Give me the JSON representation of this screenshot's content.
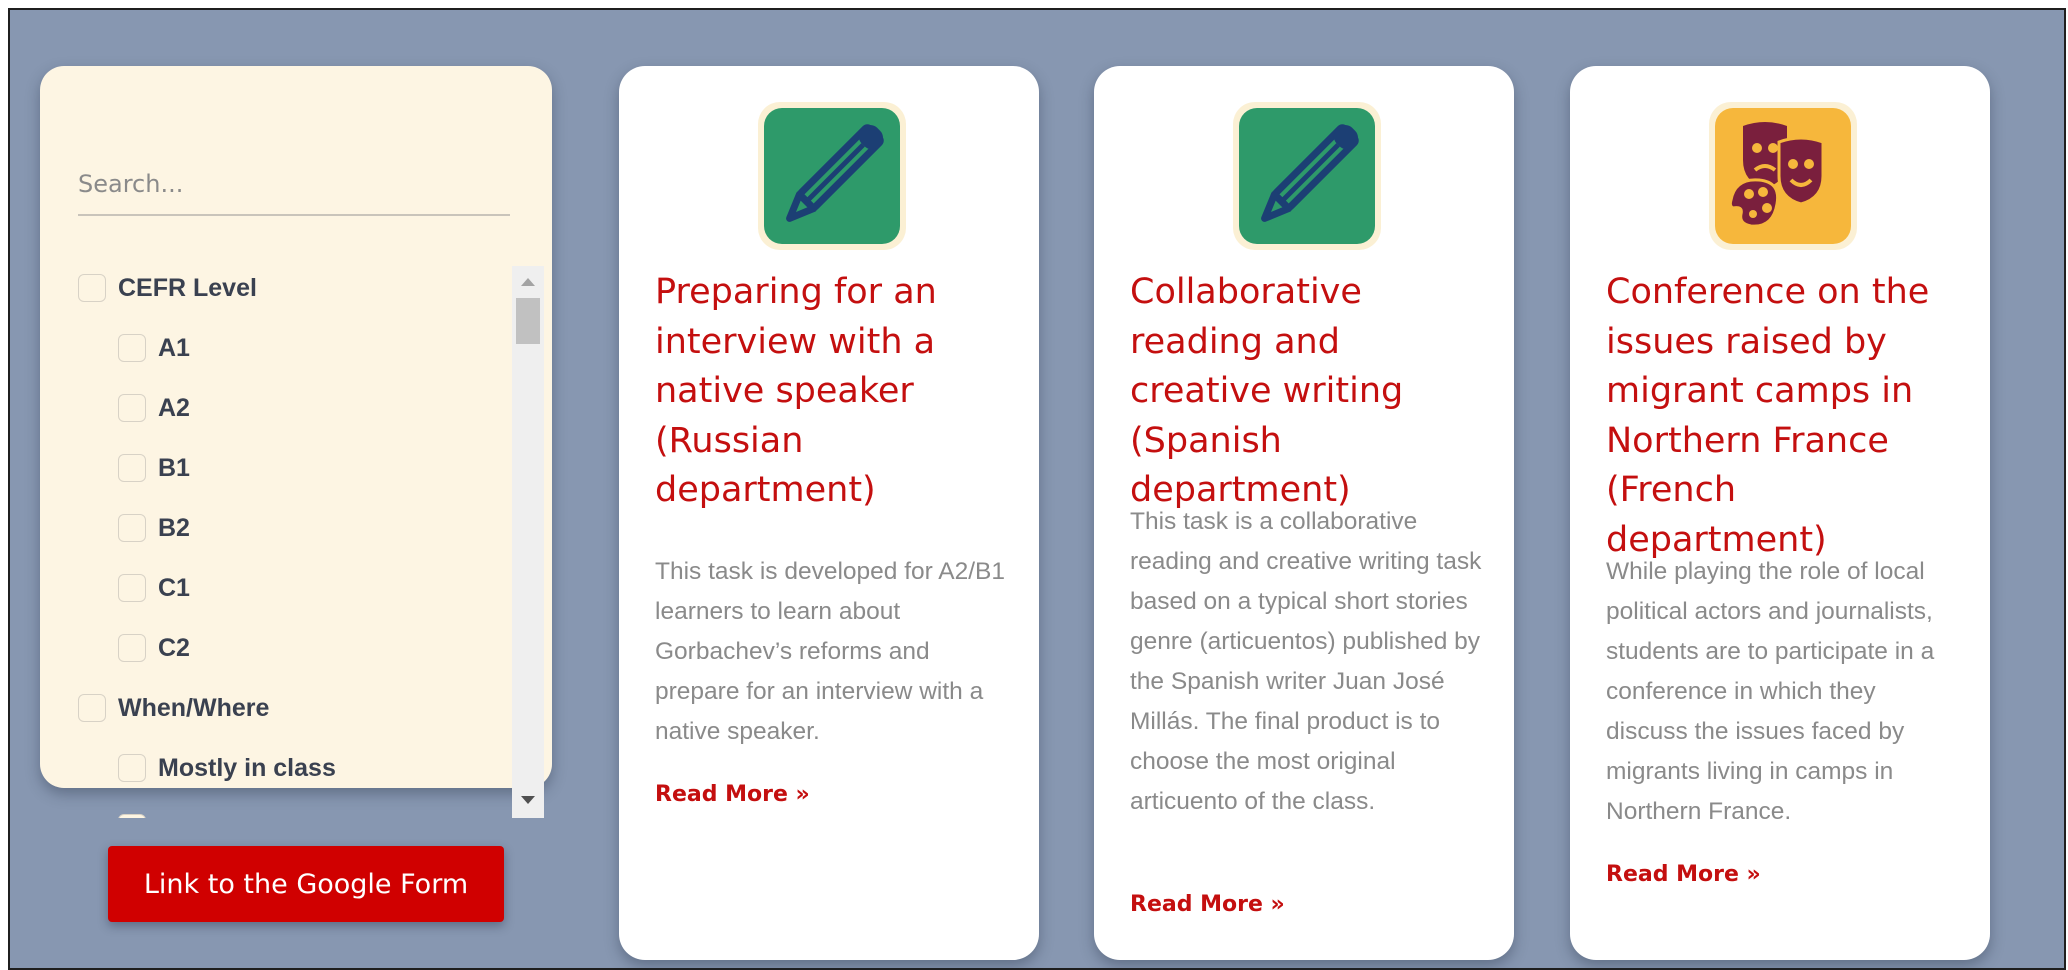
{
  "filter_panel": {
    "search": {
      "placeholder": "Search...",
      "value": ""
    },
    "items": [
      {
        "label": "CEFR Level"
      },
      {
        "label": "A1"
      },
      {
        "label": "A2"
      },
      {
        "label": "B1"
      },
      {
        "label": "B2"
      },
      {
        "label": "C1"
      },
      {
        "label": "C2"
      },
      {
        "label": "When/Where"
      },
      {
        "label": "Mostly in class"
      }
    ]
  },
  "form_button": {
    "label": "Link to the Google Form"
  },
  "cards": [
    {
      "icon": "pencil-icon",
      "title": "Preparing for an interview with a native speaker (Russian department)",
      "description": "This task is developed for A2/B1 learners to learn about Gorbachev’s reforms and prepare for an interview with a native speaker.",
      "link": "Read More »"
    },
    {
      "icon": "pencil-icon",
      "title": "Collaborative reading and creative writing (Spanish department)",
      "description": "This task is a collaborative reading and creative writing task based on a typical short stories genre (articuentos) published by the Spanish writer Juan José Millás. The final product is to choose the most original articuento of the class.",
      "link": "Read More »"
    },
    {
      "icon": "theater-masks-palette-icon",
      "title": "Conference on the issues raised by migrant camps in Northern France (French department)",
      "description": "While playing the role of local political actors and journalists, students are to participate in a conference in which they discuss the issues faced by migrants living in camps in Northern France.",
      "link": "Read More »"
    }
  ],
  "colors": {
    "page_background": "#8797b1",
    "panel_background": "#fdf5e3",
    "accent_red": "#c40f0f",
    "button_red": "#d00000",
    "icon_green": "#2e9a6a",
    "icon_orange": "#f6b73c",
    "icon_navy": "#1c3f74",
    "icon_maroon": "#7a1f3d"
  }
}
